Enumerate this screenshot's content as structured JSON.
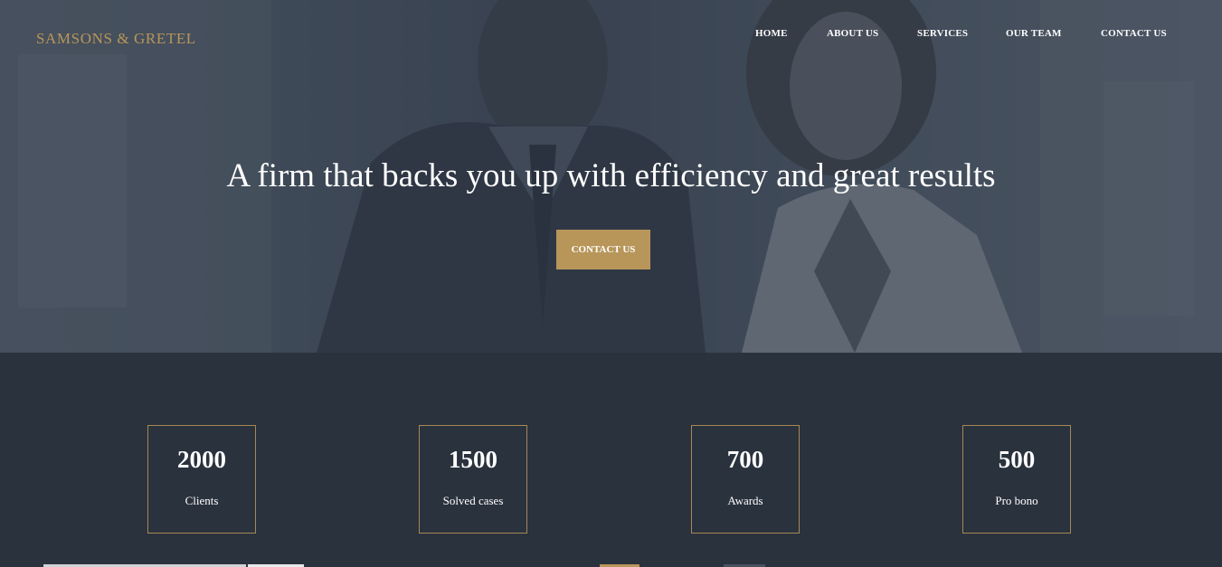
{
  "brand": {
    "name": "SAMSONS & GRETEL"
  },
  "nav": {
    "items": [
      {
        "label": "HOME"
      },
      {
        "label": "ABOUT US"
      },
      {
        "label": "SERVICES"
      },
      {
        "label": "OUR TEAM"
      },
      {
        "label": "CONTACT US"
      }
    ]
  },
  "hero": {
    "headline": "A firm that backs you up with efficiency and great results",
    "cta_label": "CONTACT US"
  },
  "stats": [
    {
      "value": "2000",
      "label": "Clients"
    },
    {
      "value": "1500",
      "label": "Solved cases"
    },
    {
      "value": "700",
      "label": "Awards"
    },
    {
      "value": "500",
      "label": "Pro bono"
    }
  ],
  "colors": {
    "accent": "#b8965a",
    "background": "#2a323d",
    "text": "#ffffff"
  }
}
